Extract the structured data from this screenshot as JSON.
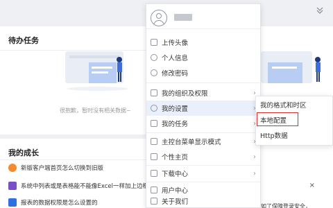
{
  "todo": {
    "title": "待办任务",
    "empty_text": "很抱歉，暂时没有相关数据~"
  },
  "growth": {
    "title": "我的成长",
    "items": [
      {
        "text": "新版客户端首页怎么切换到旧版",
        "color": "#f58b2c"
      },
      {
        "text": "系统中列表或是表格能不能像Excel一样加上边框",
        "color": "#7a4ec6"
      },
      {
        "text": "报表的数据权限是怎么设置的",
        "color": "#2f6fe0"
      }
    ]
  },
  "right_bottom": {
    "close_label": "×",
    "text": "如了保障登录安全，"
  },
  "menu": {
    "items": [
      {
        "label": "上传头像",
        "icon": "upload-avatar-icon",
        "arrow": ""
      },
      {
        "label": "个人信息",
        "icon": "user-info-icon",
        "arrow": ""
      },
      {
        "label": "修改密码",
        "icon": "password-icon",
        "arrow": ""
      },
      {
        "label": "我的组织及权限",
        "icon": "org-icon",
        "arrow": "›"
      },
      {
        "label": "我的设置",
        "icon": "settings-icon",
        "arrow": "›"
      },
      {
        "label": "我的任务",
        "icon": "task-icon",
        "arrow": "›"
      },
      {
        "label": "主控台菜单显示模式",
        "icon": "console-icon",
        "arrow": "›"
      },
      {
        "label": "个性主页",
        "icon": "homepage-icon",
        "arrow": "›"
      },
      {
        "label": "下载中心",
        "icon": "download-icon",
        "arrow": "›"
      },
      {
        "label": "用户中心",
        "icon": "user-center-icon",
        "arrow": ""
      },
      {
        "label": "关于我们",
        "icon": "about-icon",
        "arrow": ""
      }
    ]
  },
  "submenu": {
    "items": [
      {
        "label": "我的格式和时区"
      },
      {
        "label": "本地配置"
      },
      {
        "label": "Http数据"
      }
    ]
  },
  "colors": {
    "accent": "#3b6fe0",
    "highlight": "#e02b2b",
    "active_bg": "#eaf0fb"
  }
}
